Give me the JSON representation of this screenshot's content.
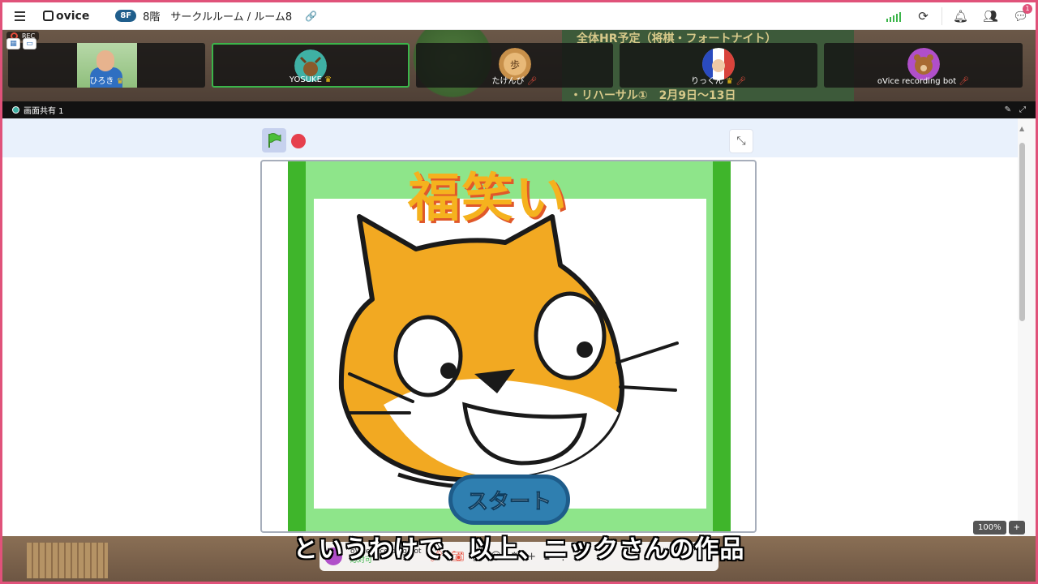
{
  "topbar": {
    "brand": "ovice",
    "floor_badge": "8F",
    "room_title": "8階　サークルルーム / ルーム8",
    "notification_count": "1"
  },
  "recording": {
    "label": "REC"
  },
  "participants": [
    {
      "name": "ひろき",
      "crown": true,
      "muted": false,
      "active": false,
      "avatar_color": "#9fcf8f"
    },
    {
      "name": "YOSUKE",
      "crown": true,
      "muted": false,
      "active": true,
      "avatar_color": "#3fb0a4"
    },
    {
      "name": "たけんぴ",
      "crown": false,
      "muted": true,
      "active": false,
      "avatar_color": "#c8904a"
    },
    {
      "name": "りっくん",
      "crown": true,
      "muted": true,
      "active": false,
      "avatar_color": "#d9433b"
    },
    {
      "name": "oVice recording bot",
      "crown": false,
      "muted": true,
      "active": false,
      "avatar_color": "#b04fc9"
    }
  ],
  "space_board": {
    "line1": "全体HR予定（将棋・フォートナイト）",
    "line2": "・リハーサル①　2月9日〜13日"
  },
  "screen_share": {
    "label": "画面共有 1"
  },
  "stage": {
    "title_text": "福笑い",
    "start_button": "スタート"
  },
  "zoom": {
    "level": "100%",
    "plus": "+"
  },
  "bottom_bar": {
    "user_name": "oVice recording bot",
    "status": "応対可"
  },
  "subtitle": "というわけで、以上、ニックさんの作品",
  "colors": {
    "accent": "#e0527a",
    "green": "#3fb52b",
    "cat_orange": "#f2a922"
  }
}
